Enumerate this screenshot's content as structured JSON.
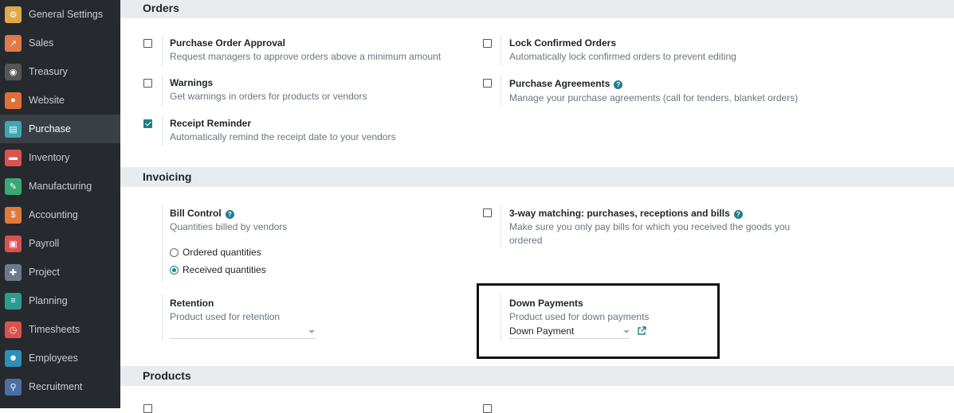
{
  "sidebar": {
    "items": [
      {
        "label": "General Settings",
        "icon": "gear-icon",
        "color": "#e0a848"
      },
      {
        "label": "Sales",
        "icon": "chart-icon",
        "color": "#e07a4a"
      },
      {
        "label": "Treasury",
        "icon": "eye-icon",
        "color": "#555555"
      },
      {
        "label": "Website",
        "icon": "globe-icon",
        "color": "#e0703a"
      },
      {
        "label": "Purchase",
        "icon": "card-icon",
        "color": "#3fa6b4"
      },
      {
        "label": "Inventory",
        "icon": "box-icon",
        "color": "#d9534f"
      },
      {
        "label": "Manufacturing",
        "icon": "wrench-icon",
        "color": "#3aa776"
      },
      {
        "label": "Accounting",
        "icon": "ledger-icon",
        "color": "#e07a3a"
      },
      {
        "label": "Payroll",
        "icon": "payroll-icon",
        "color": "#d9534f"
      },
      {
        "label": "Project",
        "icon": "puzzle-icon",
        "color": "#6c7a89"
      },
      {
        "label": "Planning",
        "icon": "planning-icon",
        "color": "#2a9d8f"
      },
      {
        "label": "Timesheets",
        "icon": "stopwatch-icon",
        "color": "#d9534f"
      },
      {
        "label": "Employees",
        "icon": "people-icon",
        "color": "#2f8fb5"
      },
      {
        "label": "Recruitment",
        "icon": "magnifier-icon",
        "color": "#4a6fa5"
      }
    ],
    "active": "Purchase"
  },
  "sections": {
    "orders": {
      "title": "Orders",
      "purchase_order_approval": {
        "title": "Purchase Order Approval",
        "desc": "Request managers to approve orders above a minimum amount",
        "checked": false
      },
      "lock_confirmed_orders": {
        "title": "Lock Confirmed Orders",
        "desc": "Automatically lock confirmed orders to prevent editing",
        "checked": false
      },
      "warnings": {
        "title": "Warnings",
        "desc": "Get warnings in orders for products or vendors",
        "checked": false
      },
      "purchase_agreements": {
        "title": "Purchase Agreements",
        "desc": "Manage your purchase agreements (call for tenders, blanket orders)",
        "checked": false
      },
      "receipt_reminder": {
        "title": "Receipt Reminder",
        "desc": "Automatically remind the receipt date to your vendors",
        "checked": true
      }
    },
    "invoicing": {
      "title": "Invoicing",
      "bill_control": {
        "title": "Bill Control",
        "desc": "Quantities billed by vendors",
        "options": [
          "Ordered quantities",
          "Received quantities"
        ],
        "selected": "Received quantities"
      },
      "three_way": {
        "title": "3-way matching: purchases, receptions and bills",
        "desc_line1": "Make sure you only pay bills for which you received the goods you",
        "desc_line2": "ordered",
        "checked": false
      },
      "retention": {
        "title": "Retention",
        "desc": "Product used for retention",
        "value": ""
      },
      "down_payments": {
        "title": "Down Payments",
        "desc": "Product used for down payments",
        "value": "Down Payment"
      }
    },
    "products": {
      "title": "Products"
    }
  },
  "colors": {
    "accent": "#1f7f8b",
    "sidebar_bg": "#262a2f",
    "section_bg": "#e9ecef"
  }
}
